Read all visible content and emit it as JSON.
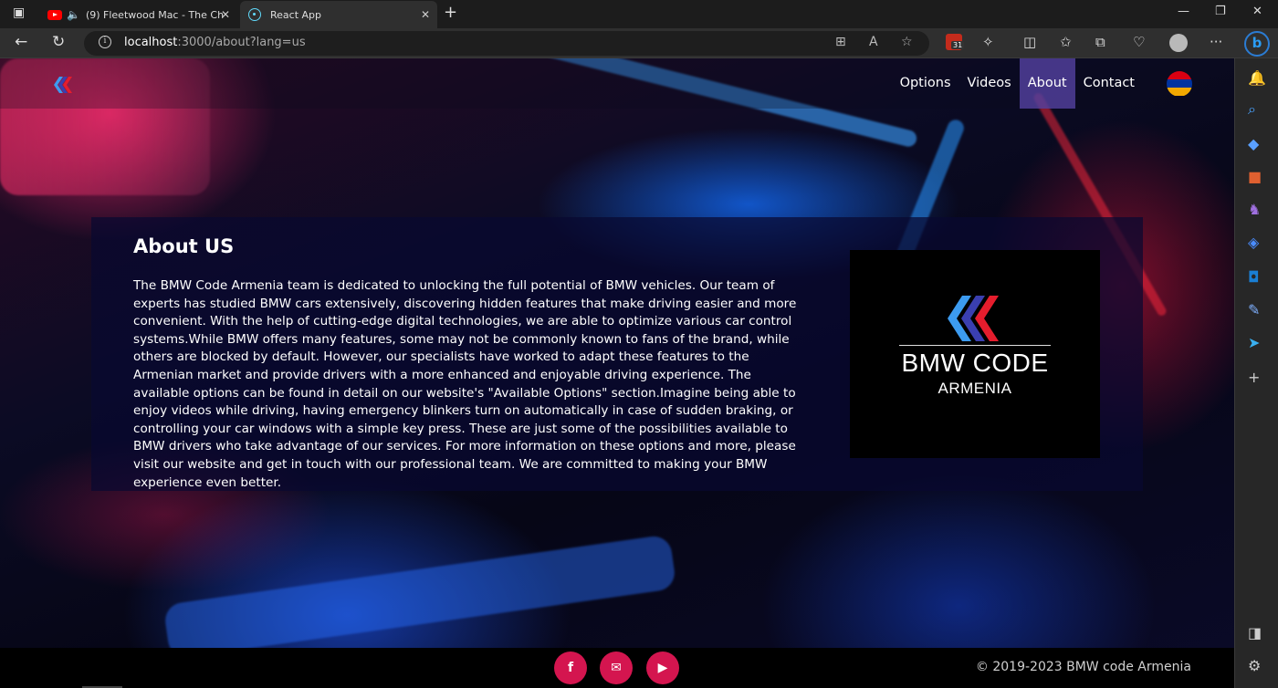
{
  "browser": {
    "tabs": [
      {
        "title": "(9) Fleetwood Mac - The Ch",
        "active": false,
        "favicon": "youtube-icon",
        "audio": "speaker-icon"
      },
      {
        "title": "React App",
        "active": true,
        "favicon": "react-icon"
      }
    ],
    "url": {
      "host": "localhost",
      "rest": ":3000/about?lang=us"
    },
    "extension_badge": "31",
    "bing_label": "b"
  },
  "site": {
    "nav": {
      "items": [
        {
          "label": "Options"
        },
        {
          "label": "Videos"
        },
        {
          "label": "About",
          "active": true
        },
        {
          "label": "Contact"
        }
      ],
      "language_flag": {
        "colors": [
          "#d90012",
          "#0033a0",
          "#f2a800"
        ]
      }
    },
    "about": {
      "title": "About US",
      "text": "The BMW Code Armenia team is dedicated to unlocking the full potential of BMW vehicles. Our team of experts has studied BMW cars extensively, discovering hidden features that make driving easier and more convenient. With the help of cutting-edge digital technologies, we are able to optimize various car control systems.While BMW offers many features, some may not be commonly known to fans of the brand, while others are blocked by default. However, our specialists have worked to adapt these features to the Armenian market and provide drivers with a more enhanced and enjoyable driving experience. The available options can be found in detail on our website's \"Available Options\" section.Imagine being able to enjoy videos while driving, having emergency blinkers turn on automatically in case of sudden braking, or controlling your car windows with a simple key press. These are just some of the possibilities available to BMW drivers who take advantage of our services. For more information on these options and more, please visit our website and get in touch with our professional team. We are committed to making your BMW experience even better.",
      "brand": {
        "name": "BMW CODE",
        "sub": "ARMENIA"
      }
    },
    "footer": {
      "social": [
        {
          "icon": "facebook-icon",
          "glyph": "f"
        },
        {
          "icon": "mail-icon",
          "glyph": "✉"
        },
        {
          "icon": "youtube-icon",
          "glyph": "▶"
        }
      ],
      "copyright": "© 2019-2023 BMW code Armenia"
    },
    "colors": {
      "accent": "#d4154f",
      "nav_active": "#5a46aa",
      "chevron_blue_light": "#3c9bf0",
      "chevron_blue_dark": "#3a3fb0",
      "chevron_red": "#e51d2d"
    }
  }
}
